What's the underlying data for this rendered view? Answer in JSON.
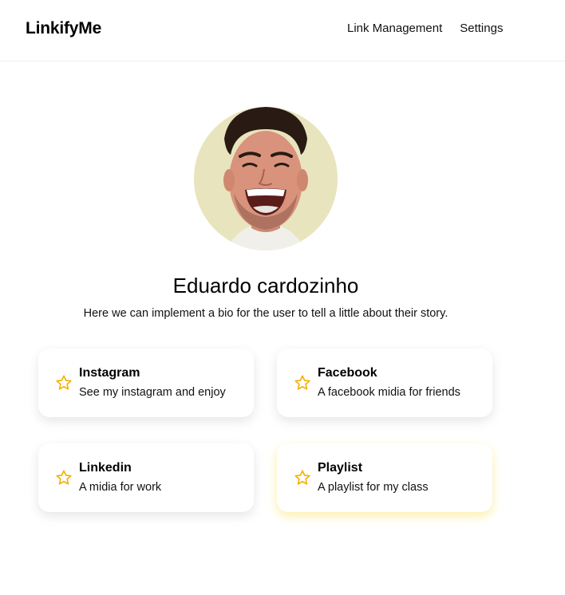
{
  "header": {
    "brand": "LinkifyMe",
    "nav": [
      "Link Management",
      "Settings"
    ]
  },
  "profile": {
    "avatar_alt": "profile-photo",
    "name": "Eduardo cardozinho",
    "bio": "Here we can implement a bio for the user to tell a little about their story."
  },
  "links": [
    {
      "title": "Instagram",
      "description": "See my instagram and enjoy",
      "icon": "star-icon",
      "featured": false
    },
    {
      "title": "Facebook",
      "description": "A facebook midia for friends",
      "icon": "star-icon",
      "featured": false
    },
    {
      "title": "Linkedin",
      "description": "A midia for work",
      "icon": "star-icon",
      "featured": false
    },
    {
      "title": "Playlist",
      "description": "A playlist for my class",
      "icon": "star-icon",
      "featured": true
    }
  ],
  "colors": {
    "star": "#f5b000",
    "avatar_bg": "#e8e4bd",
    "featured_glow": "#fad628"
  }
}
